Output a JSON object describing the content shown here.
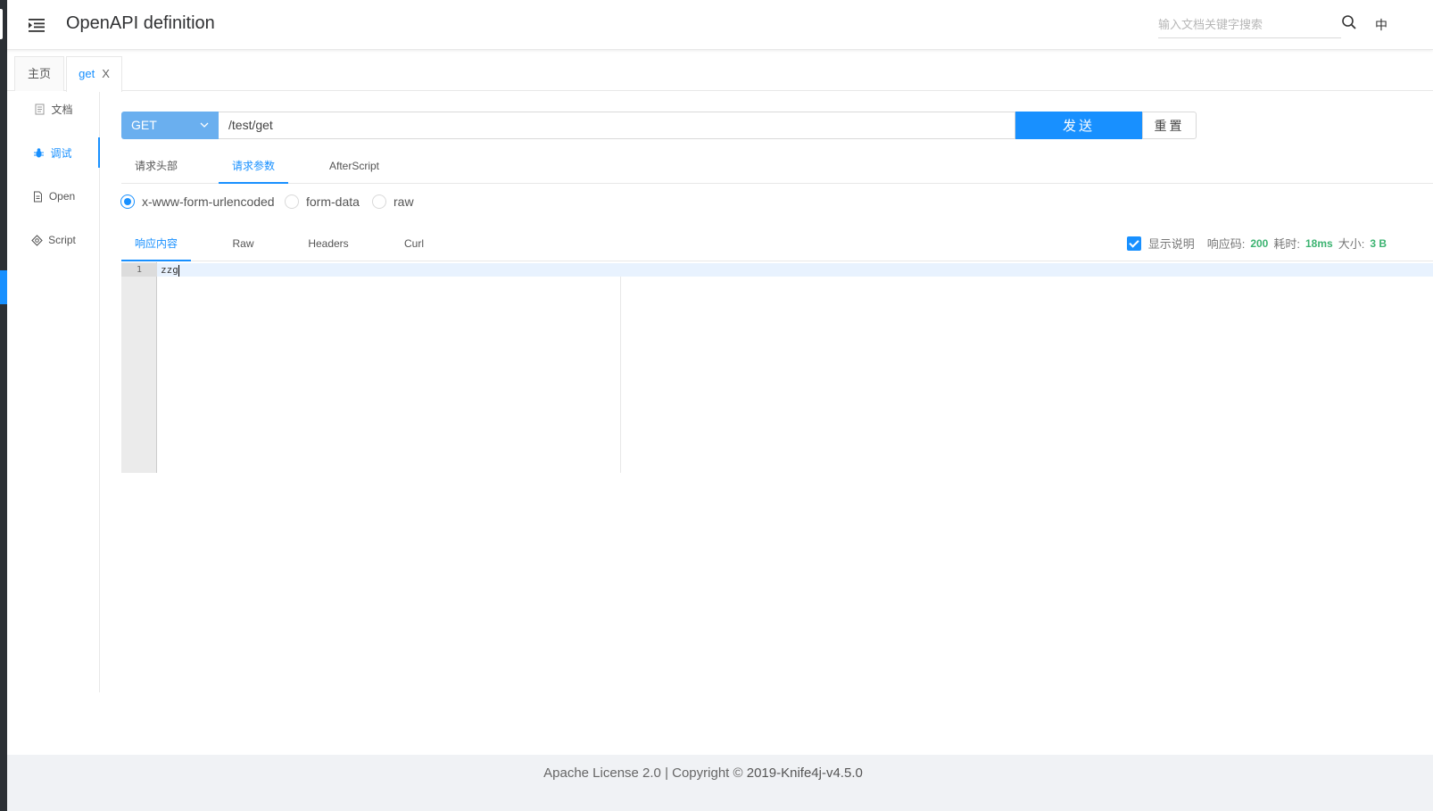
{
  "header": {
    "title": "OpenAPI definition",
    "search_placeholder": "输入文档关键字搜索",
    "lang": "中"
  },
  "page_tabs": [
    {
      "label": "主页",
      "active": false
    },
    {
      "label": "get",
      "active": true,
      "close": "X"
    }
  ],
  "sidenav": [
    {
      "label": "文档",
      "icon": "document-icon",
      "active": false
    },
    {
      "label": "调试",
      "icon": "bug-icon",
      "active": true
    },
    {
      "label": "Open",
      "icon": "file-icon",
      "active": false
    },
    {
      "label": "Script",
      "icon": "code-icon",
      "active": false
    }
  ],
  "request": {
    "method": "GET",
    "url": "/test/get",
    "send_label": "发送",
    "reset_label": "重置"
  },
  "request_tabs": [
    {
      "label": "请求头部",
      "active": false
    },
    {
      "label": "请求参数",
      "active": true
    },
    {
      "label": "AfterScript",
      "active": false
    }
  ],
  "body_types": [
    {
      "label": "x-www-form-urlencoded",
      "checked": true
    },
    {
      "label": "form-data",
      "checked": false
    },
    {
      "label": "raw",
      "checked": false
    }
  ],
  "response_tabs": [
    {
      "label": "响应内容",
      "active": true
    },
    {
      "label": "Raw",
      "active": false
    },
    {
      "label": "Headers",
      "active": false
    },
    {
      "label": "Curl",
      "active": false
    }
  ],
  "response_meta": {
    "show_desc_label": "显示说明",
    "code_label": "响应码:",
    "code": "200",
    "time_label": "耗时:",
    "time": "18ms",
    "size_label": "大小:",
    "size": "3 B"
  },
  "editor": {
    "line_number": "1",
    "content": "zzg"
  },
  "footer": {
    "text": "Apache License 2.0 | Copyright",
    "copyright_symbol": "©",
    "brand": " 2019-Knife4j-v4.5.0"
  },
  "colors": {
    "accent": "#1890ff",
    "method_bg": "#6aafef",
    "success": "#3cb371"
  }
}
